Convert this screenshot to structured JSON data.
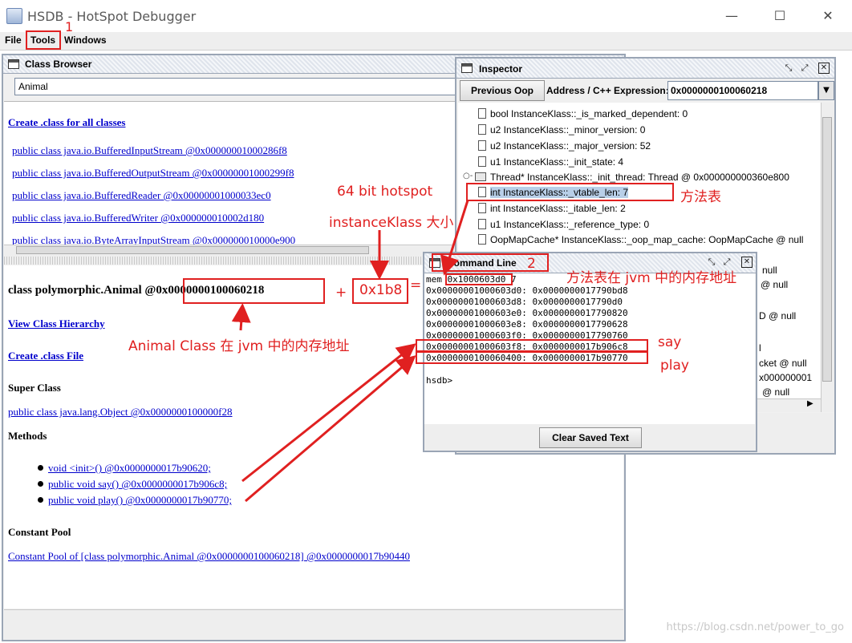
{
  "window": {
    "title": "HSDB - HotSpot Debugger",
    "minimize": "—",
    "maximize": "☐",
    "close": "✕"
  },
  "menu": {
    "file": "File",
    "tools": "Tools",
    "windows": "Windows"
  },
  "class_browser": {
    "title": "Class Browser",
    "search_value": "Animal",
    "create_all_link": "Create .class for all classes",
    "class_list": [
      "public class java.io.BufferedInputStream @0x00000001000286f8",
      "public class java.io.BufferedOutputStream @0x00000001000299f8",
      "public class java.io.BufferedReader @0x00000001000033ec0",
      "public class java.io.BufferedWriter @0x000000010002d180",
      "public class java.io.ByteArrayInputStream @0x000000010000e900"
    ],
    "detail": {
      "class_prefix": "class polymorphic.Animal @",
      "class_address": "0x0000000100060218",
      "view_hierarchy": "View Class Hierarchy",
      "create_class_file": "Create .class File",
      "super_class_heading": "Super Class",
      "super_class_link": "public class java.lang.Object @0x0000000100000f28",
      "methods_heading": "Methods",
      "methods": [
        "void <init>() @0x0000000017b90620;",
        "public void say() @0x0000000017b906c8;",
        "public void play() @0x0000000017b90770;"
      ],
      "constant_pool_heading": "Constant Pool",
      "constant_pool_link": "Constant Pool of [class polymorphic.Animal @0x0000000100060218] @0x0000000017b90440"
    }
  },
  "inspector": {
    "title": "Inspector",
    "previous_oop": "Previous Oop",
    "address_label": "Address / C++ Expression:",
    "address_value": "0x0000000100060218",
    "tree_items": [
      "bool InstanceKlass::_is_marked_dependent: 0",
      "u2 InstanceKlass::_minor_version: 0",
      "u2 InstanceKlass::_major_version: 52",
      "u1 InstanceKlass::_init_state: 4",
      "Thread* InstanceKlass::_init_thread: Thread @ 0x000000000360e800",
      "int InstanceKlass::_vtable_len: 7",
      "int InstanceKlass::_itable_len: 2",
      "u1 InstanceKlass::_reference_type: 0",
      "OopMapCache* InstanceKlass::_oop_map_cache: OopMapCache @ null"
    ],
    "hidden_fragments": [
      "null",
      "@ null",
      "D @ null",
      "l",
      "cket @ null",
      "x000000001",
      "@ null"
    ]
  },
  "command_line": {
    "title": "Command Line",
    "mem_prefix": "mem ",
    "mem_address": "0x1000603d0",
    "mem_count": " 7",
    "output_lines": [
      "0x00000001000603d0: 0x0000000017790bd8",
      "0x00000001000603d8: 0x0000000017790d0",
      "0x00000001000603e0: 0x0000000017790820",
      "0x00000001000603e8: 0x0000000017790628",
      "0x00000001000603f0: 0x0000000017790760",
      "0x00000001000603f8: 0x0000000017b906c8",
      "0x0000000100060400: 0x0000000017b90770"
    ],
    "prompt": "hsdb>",
    "clear_button": "Clear Saved Text"
  },
  "annotations": {
    "step1": "1",
    "step2": "2",
    "hotspot_64": "64 bit hotspot",
    "instance_klass_size": "instanceKlass 大小",
    "plus": "+",
    "offset": "0x1b8",
    "equals": "=",
    "vtable": "方法表",
    "vtable_address": "方法表在 jvm 中的内存地址",
    "animal_class_address": "Animal Class 在 jvm 中的内存地址",
    "say": "say",
    "play": "play"
  },
  "watermark": "https://blog.csdn.net/power_to_go",
  "colors": {
    "annotation_red": "#e02020",
    "link_blue": "#0000cc",
    "frame_border": "#9aa5b5"
  }
}
